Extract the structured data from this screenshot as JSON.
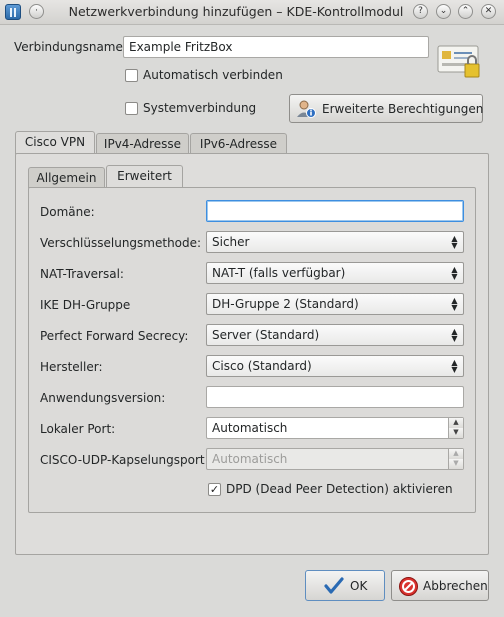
{
  "window": {
    "title": "Netzwerkverbindung hinzufügen – KDE-Kontrollmodul"
  },
  "header": {
    "connection_name_label": "Verbindungsname:",
    "connection_name_value": "Example FritzBox",
    "auto_connect_label": "Automatisch verbinden",
    "system_connection_label": "Systemverbindung",
    "advanced_permissions_label": "Erweiterte Berechtigungen"
  },
  "tabs": [
    {
      "label": "Cisco VPN",
      "active": true
    },
    {
      "label": "IPv4-Adresse",
      "active": false
    },
    {
      "label": "IPv6-Adresse",
      "active": false
    }
  ],
  "subtabs": [
    {
      "label": "Allgemein",
      "active": false
    },
    {
      "label": "Erweitert",
      "active": true
    }
  ],
  "form": {
    "domain": {
      "label": "Domäne:",
      "value": ""
    },
    "encryption": {
      "label": "Verschlüsselungsmethode:",
      "value": "Sicher"
    },
    "nat": {
      "label": "NAT-Traversal:",
      "value": "NAT-T (falls verfügbar)"
    },
    "ike": {
      "label": "IKE DH-Gruppe",
      "value": "DH-Gruppe 2 (Standard)"
    },
    "pfs": {
      "label": "Perfect Forward Secrecy:",
      "value": "Server (Standard)"
    },
    "vendor": {
      "label": "Hersteller:",
      "value": "Cisco (Standard)"
    },
    "appversion": {
      "label": "Anwendungsversion:",
      "value": ""
    },
    "localport": {
      "label": "Lokaler Port:",
      "value": "Automatisch"
    },
    "udpport": {
      "label": "CISCO-UDP-Kapselungsport:",
      "value": "Automatisch"
    },
    "dpd": {
      "label": "DPD (Dead Peer Detection) aktivieren",
      "checked": true
    }
  },
  "buttons": {
    "ok": "OK",
    "cancel": "Abbrechen"
  }
}
